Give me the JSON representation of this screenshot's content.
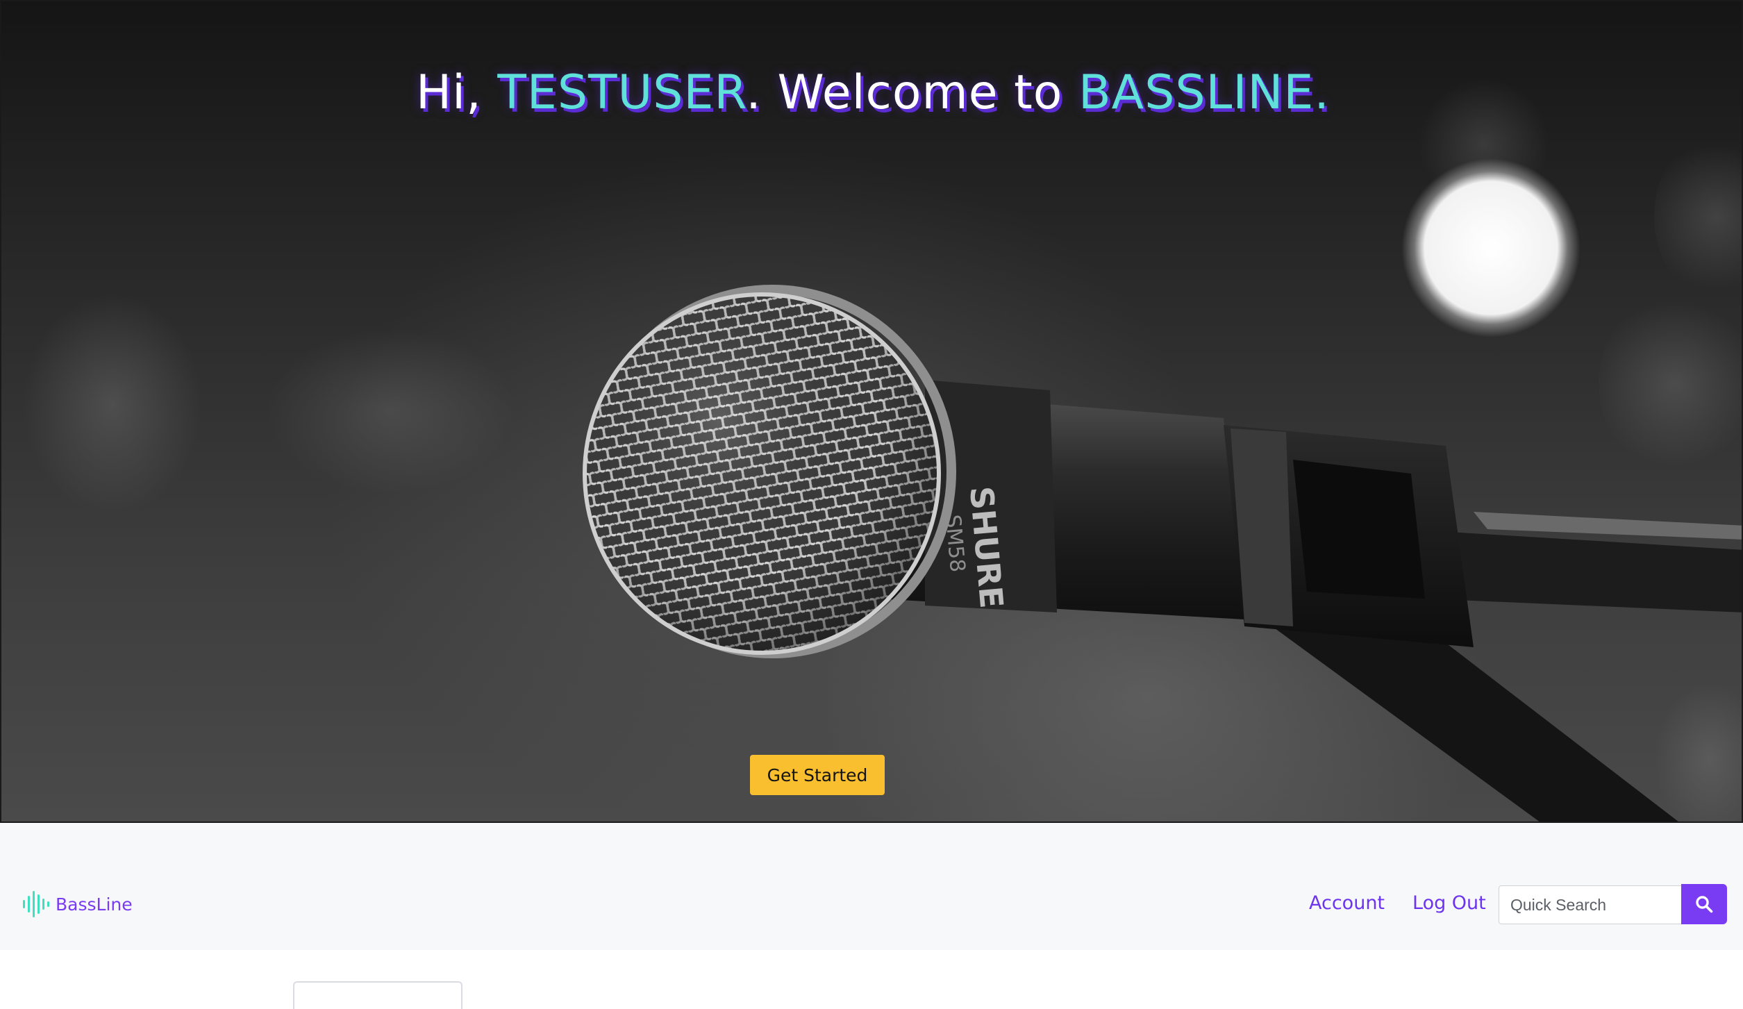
{
  "hero": {
    "greeting": "Hi, ",
    "username": "TESTUSER",
    "mid_text": ". Welcome to ",
    "app_name": "BASSLINE",
    "end_text": ".",
    "cta_label": "Get Started",
    "image_description_icon": "microphone-photo",
    "mic_brand_text": "SHURE",
    "mic_model_text": "SM58"
  },
  "navbar": {
    "brand_name": "BassLine",
    "brand_icon": "sound-wave-icon",
    "links": [
      {
        "label": "Account"
      },
      {
        "label": "Log Out"
      }
    ],
    "search": {
      "placeholder": "Quick Search",
      "button_icon": "search-icon"
    }
  },
  "colors": {
    "accent_teal": "#5fe0d8",
    "accent_purple": "#7a3cf2",
    "cta_yellow": "#f9bf2f",
    "navbar_bg": "#f7f8fa"
  }
}
